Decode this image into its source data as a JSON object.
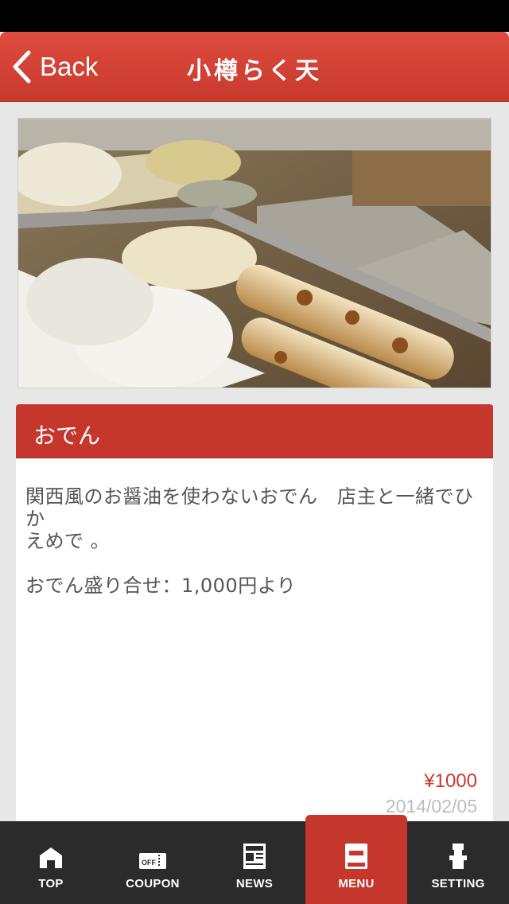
{
  "nav": {
    "back_label": "Back",
    "title": "小樽らく天"
  },
  "photo": {
    "description_icon": "oden-photo"
  },
  "item": {
    "name": "おでん",
    "description_line1": "関西風のお醤油を使わないおでん　店主と一緒でひか",
    "description_line2": "えめで 。",
    "description_line3": "おでん盛り合せ：1,000円より",
    "price": "¥1000",
    "date": "2014/02/05"
  },
  "tabs": [
    {
      "label": "TOP",
      "icon": "home-icon"
    },
    {
      "label": "COUPON",
      "icon": "coupon-icon"
    },
    {
      "label": "NEWS",
      "icon": "news-icon"
    },
    {
      "label": "MENU",
      "icon": "menu-book-icon",
      "active": true
    },
    {
      "label": "SETTING",
      "icon": "setting-icon"
    }
  ],
  "colors": {
    "accent": "#c5372c",
    "tabbar": "#2b2b2b",
    "background": "#e7e7e7"
  }
}
